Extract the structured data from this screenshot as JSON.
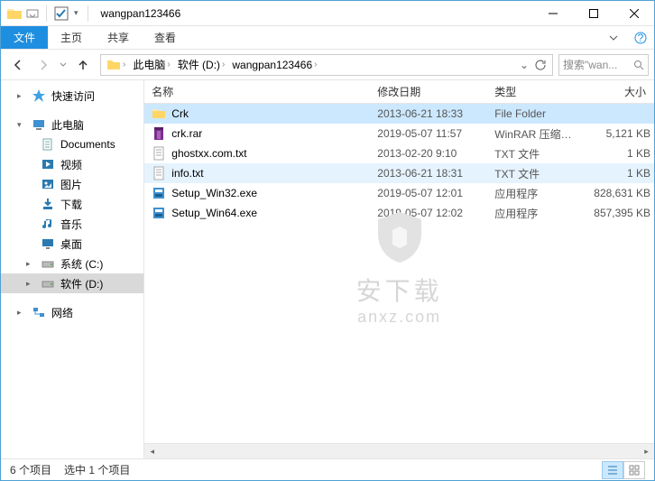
{
  "window": {
    "title": "wangpan123466"
  },
  "ribbon": {
    "file": "文件",
    "tabs": [
      "主页",
      "共享",
      "查看"
    ]
  },
  "breadcrumbs": [
    "此电脑",
    "软件 (D:)",
    "wangpan123466"
  ],
  "search": {
    "placeholder": "搜索\"wan..."
  },
  "sidebar": {
    "quick": "快速访问",
    "thispc": "此电脑",
    "items": [
      "Documents",
      "视频",
      "图片",
      "下载",
      "音乐",
      "桌面",
      "系统 (C:)",
      "软件 (D:)"
    ],
    "network": "网络"
  },
  "columns": {
    "name": "名称",
    "date": "修改日期",
    "type": "类型",
    "size": "大小"
  },
  "files": [
    {
      "name": "Crk",
      "date": "2013-06-21 18:33",
      "type": "File Folder",
      "size": "",
      "icon": "folder",
      "state": "selected"
    },
    {
      "name": "crk.rar",
      "date": "2019-05-07 11:57",
      "type": "WinRAR 压缩文件",
      "size": "5,121 KB",
      "icon": "rar",
      "state": ""
    },
    {
      "name": "ghostxx.com.txt",
      "date": "2013-02-20 9:10",
      "type": "TXT 文件",
      "size": "1 KB",
      "icon": "txt",
      "state": ""
    },
    {
      "name": "info.txt",
      "date": "2013-06-21 18:31",
      "type": "TXT 文件",
      "size": "1 KB",
      "icon": "txt",
      "state": "hover"
    },
    {
      "name": "Setup_Win32.exe",
      "date": "2019-05-07 12:01",
      "type": "应用程序",
      "size": "828,631 KB",
      "icon": "exe",
      "state": ""
    },
    {
      "name": "Setup_Win64.exe",
      "date": "2019-05-07 12:02",
      "type": "应用程序",
      "size": "857,395 KB",
      "icon": "exe",
      "state": ""
    }
  ],
  "status": {
    "count": "6 个项目",
    "selected": "选中 1 个项目"
  },
  "watermark": {
    "line1": "安下载",
    "line2": "anxz.com"
  }
}
